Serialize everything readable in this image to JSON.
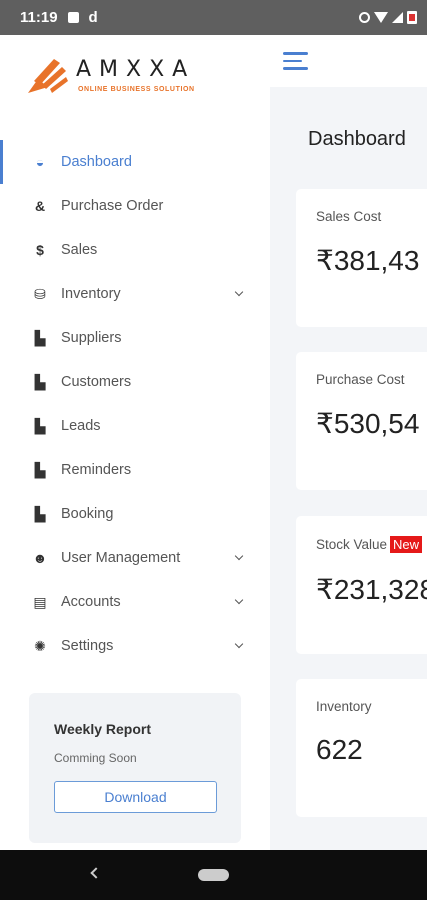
{
  "status_bar": {
    "time": "11:19",
    "app_icon": "d"
  },
  "logo": {
    "title": "AMXXA",
    "subtitle": "ONLINE BUSINESS SOLUTION",
    "brand_color": "#e8732a"
  },
  "sidebar": {
    "items": [
      {
        "label": "Dashboard",
        "icon": "speedometer-icon",
        "active": true
      },
      {
        "label": "Purchase Order",
        "icon": "handshake-icon"
      },
      {
        "label": "Sales",
        "icon": "dollar-icon"
      },
      {
        "label": "Inventory",
        "icon": "box-icon",
        "expandable": true
      },
      {
        "label": "Suppliers",
        "icon": "warehouse-icon"
      },
      {
        "label": "Customers",
        "icon": "warehouse-icon"
      },
      {
        "label": "Leads",
        "icon": "warehouse-icon"
      },
      {
        "label": "Reminders",
        "icon": "warehouse-icon"
      },
      {
        "label": "Booking",
        "icon": "warehouse-icon"
      },
      {
        "label": "User Management",
        "icon": "users-icon",
        "expandable": true
      },
      {
        "label": "Accounts",
        "icon": "ledger-icon",
        "expandable": true
      },
      {
        "label": "Settings",
        "icon": "gear-icon",
        "expandable": true
      }
    ]
  },
  "report": {
    "title": "Weekly Report",
    "subtitle": "Comming Soon",
    "button": "Download"
  },
  "main": {
    "title": "Dashboard",
    "cards": [
      {
        "label": "Sales Cost",
        "value": "₹381,43"
      },
      {
        "label": "Purchase Cost",
        "value": "₹530,54"
      },
      {
        "label": "Stock Value",
        "badge": "New",
        "value": "₹231,328"
      },
      {
        "label": "Inventory",
        "value": "622"
      }
    ]
  },
  "colors": {
    "accent": "#4a7fd0",
    "badge": "#e51919",
    "main_bg": "#f3f5f8"
  }
}
